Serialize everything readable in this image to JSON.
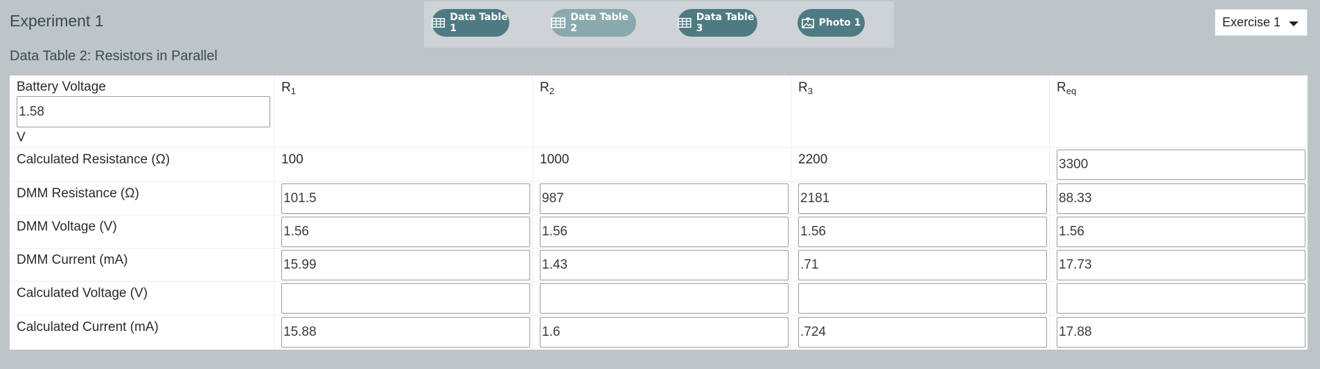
{
  "header": {
    "title": "Experiment 1",
    "tabs": [
      {
        "label": "Data Table 1",
        "icon": "table-icon",
        "active": false
      },
      {
        "label": "Data Table 2",
        "icon": "table-icon",
        "active": true
      },
      {
        "label": "Data Table 3",
        "icon": "table-icon",
        "active": false
      },
      {
        "label": "Photo 1",
        "icon": "photo-upload-icon",
        "active": false
      }
    ],
    "exercise_select": {
      "value": "Exercise 1"
    }
  },
  "table": {
    "caption": "Data Table 2: Resistors in Parallel",
    "battery": {
      "label": "Battery Voltage",
      "value": "1.58",
      "unit": "V"
    },
    "columns": [
      {
        "base": "R",
        "sub": "1"
      },
      {
        "base": "R",
        "sub": "2"
      },
      {
        "base": "R",
        "sub": "3"
      },
      {
        "base": "R",
        "sub": "eq"
      }
    ],
    "rows": [
      {
        "label": "Calculated Resistance (Ω)",
        "static": [
          "100",
          "1000",
          "2200"
        ],
        "values": [
          "",
          "",
          "",
          "3300"
        ]
      },
      {
        "label": "DMM Resistance (Ω)",
        "values": [
          "101.5",
          "987",
          "2181",
          "88.33"
        ]
      },
      {
        "label": "DMM Voltage (V)",
        "values": [
          "1.56",
          "1.56",
          "1.56",
          "1.56"
        ]
      },
      {
        "label": "DMM Current (mA)",
        "values": [
          "15.99",
          "1.43",
          ".71",
          "17.73"
        ]
      },
      {
        "label": "Calculated Voltage (V)",
        "values": [
          "",
          "",
          "",
          ""
        ]
      },
      {
        "label": "Calculated Current (mA)",
        "values": [
          "15.88",
          "1.6",
          ".724",
          "17.88"
        ]
      }
    ]
  },
  "colors": {
    "background": "#bdc5c8",
    "tab_bar": "#ced3d5",
    "tab": "#4e7b83",
    "tab_active": "#8aa9ae",
    "title_text": "#3b4a52"
  }
}
